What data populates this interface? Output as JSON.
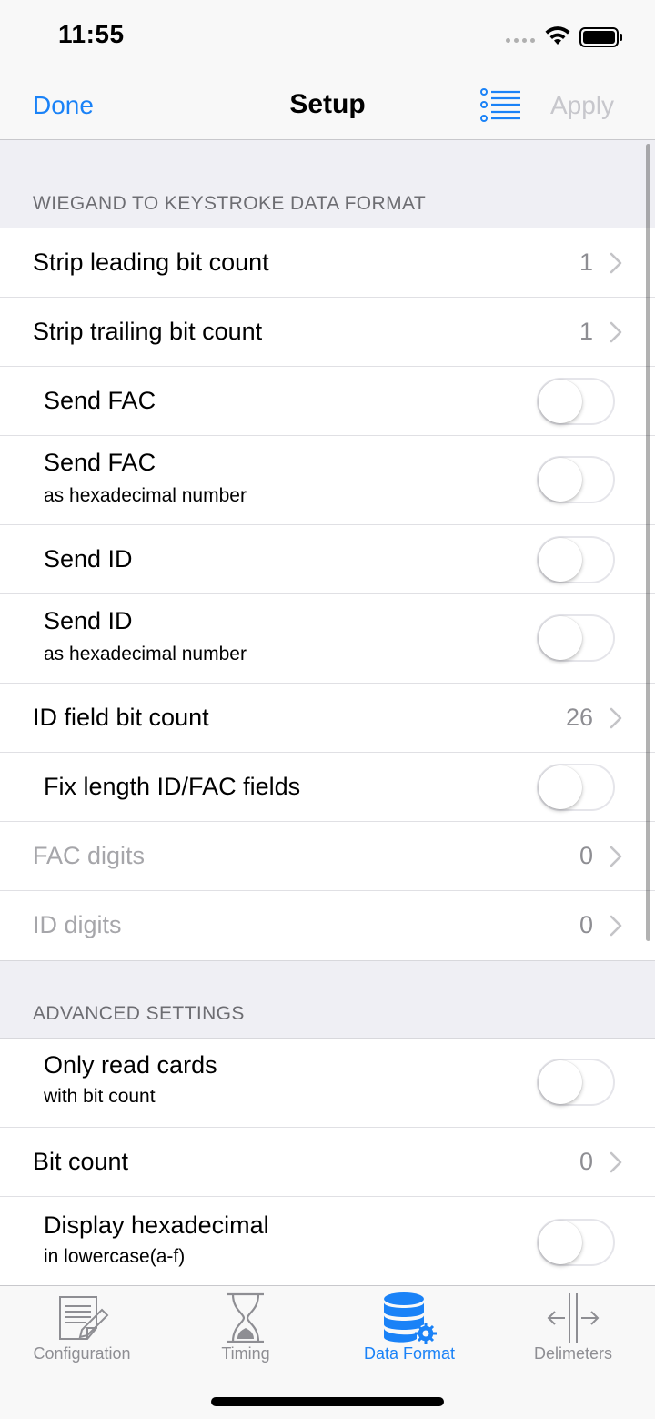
{
  "status": {
    "time": "11:55"
  },
  "nav": {
    "done": "Done",
    "title": "Setup",
    "apply": "Apply"
  },
  "sections": [
    {
      "header": "WIEGAND TO KEYSTROKE DATA FORMAT",
      "rows": [
        {
          "label": "Strip leading bit count",
          "value": "1",
          "kind": "disclosure"
        },
        {
          "label": "Strip trailing bit count",
          "value": "1",
          "kind": "disclosure"
        },
        {
          "label": "Send FAC",
          "kind": "toggle",
          "on": false
        },
        {
          "label": "Send FAC",
          "sub": "as hexadecimal number",
          "kind": "toggle",
          "on": false
        },
        {
          "label": "Send ID",
          "kind": "toggle",
          "on": false
        },
        {
          "label": "Send ID",
          "sub": "as hexadecimal number",
          "kind": "toggle",
          "on": false
        },
        {
          "label": "ID field bit count",
          "value": "26",
          "kind": "disclosure"
        },
        {
          "label": "Fix length ID/FAC fields",
          "kind": "toggle",
          "on": false
        },
        {
          "label": "FAC digits",
          "value": "0",
          "kind": "disclosure",
          "disabled": true
        },
        {
          "label": "ID digits",
          "value": "0",
          "kind": "disclosure",
          "disabled": true
        }
      ]
    },
    {
      "header": "ADVANCED SETTINGS",
      "rows": [
        {
          "label": "Only read cards",
          "sub": "with bit count",
          "kind": "toggle",
          "on": false
        },
        {
          "label": "Bit count",
          "value": "0",
          "kind": "disclosure"
        },
        {
          "label": "Display hexadecimal",
          "sub": "in lowercase(a-f)",
          "kind": "toggle",
          "on": false
        }
      ]
    }
  ],
  "tabs": [
    {
      "label": "Configuration",
      "icon": "configuration-icon",
      "active": false
    },
    {
      "label": "Timing",
      "icon": "hourglass-icon",
      "active": false
    },
    {
      "label": "Data Format",
      "icon": "database-gear-icon",
      "active": true
    },
    {
      "label": "Delimeters",
      "icon": "delimiters-icon",
      "active": false
    }
  ],
  "colors": {
    "accent": "#1a82f7",
    "inactive": "#8e8e93",
    "disabled": "#a6a6aa"
  }
}
